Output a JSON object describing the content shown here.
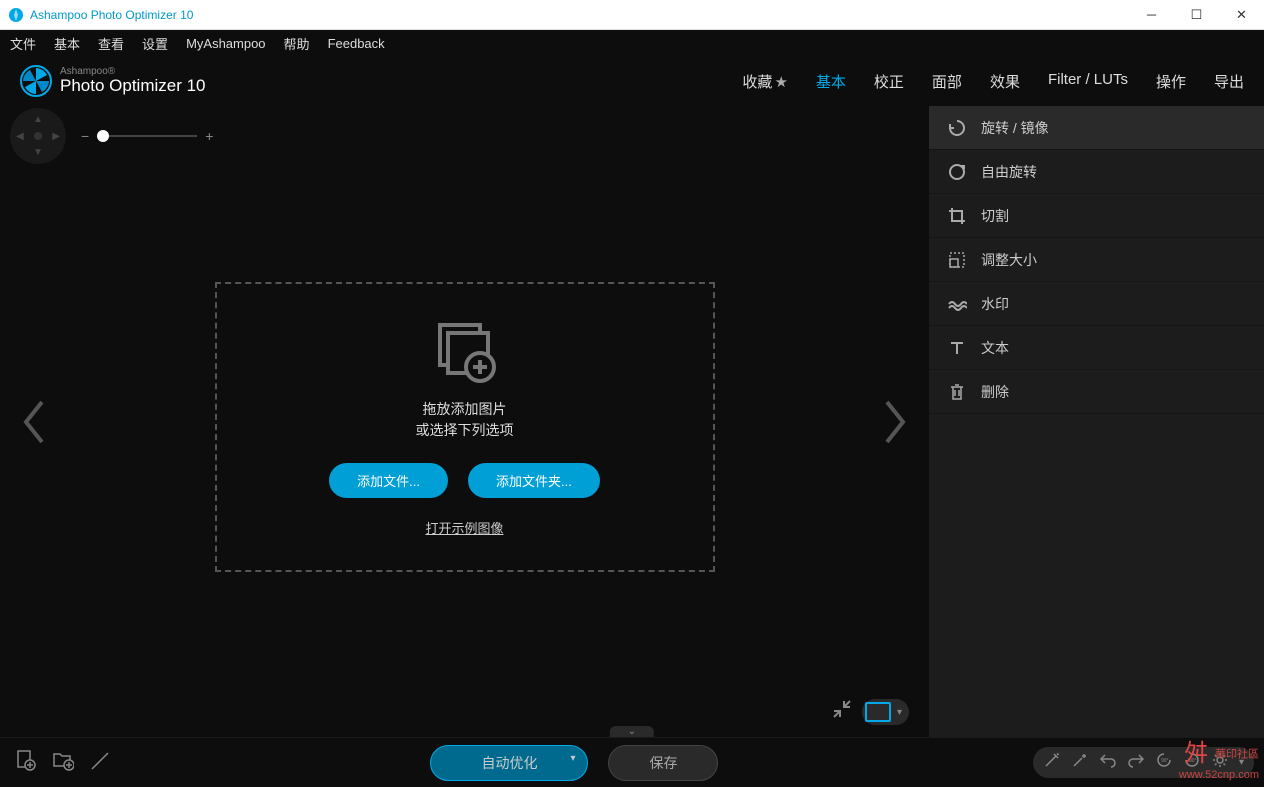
{
  "titlebar": {
    "text": "Ashampoo Photo Optimizer 10"
  },
  "menubar": {
    "items": [
      "文件",
      "基本",
      "查看",
      "设置",
      "MyAshampoo",
      "帮助",
      "Feedback"
    ]
  },
  "logo": {
    "brand": "Ashampoo®",
    "title": "Photo Optimizer 10"
  },
  "header_tabs": {
    "favorites": "收藏",
    "items": [
      "基本",
      "校正",
      "面部",
      "效果",
      "Filter / LUTs",
      "操作",
      "导出"
    ],
    "active_index": 0
  },
  "dropzone": {
    "line1": "拖放添加图片",
    "line2": "或选择下列选项",
    "add_files": "添加文件...",
    "add_folder": "添加文件夹...",
    "sample": "打开示例图像"
  },
  "side_panel": {
    "items": [
      {
        "icon": "rotate",
        "label": "旋转 / 镜像"
      },
      {
        "icon": "free-rotate",
        "label": "自由旋转"
      },
      {
        "icon": "crop",
        "label": "切割"
      },
      {
        "icon": "resize",
        "label": "调整大小"
      },
      {
        "icon": "watermark",
        "label": "水印"
      },
      {
        "icon": "text",
        "label": "文本"
      },
      {
        "icon": "delete",
        "label": "删除"
      }
    ]
  },
  "footer": {
    "auto_optimize": "自动优化",
    "save": "保存"
  },
  "watermark": {
    "line1": "華印社區",
    "line2": "www.52cnp.com"
  }
}
